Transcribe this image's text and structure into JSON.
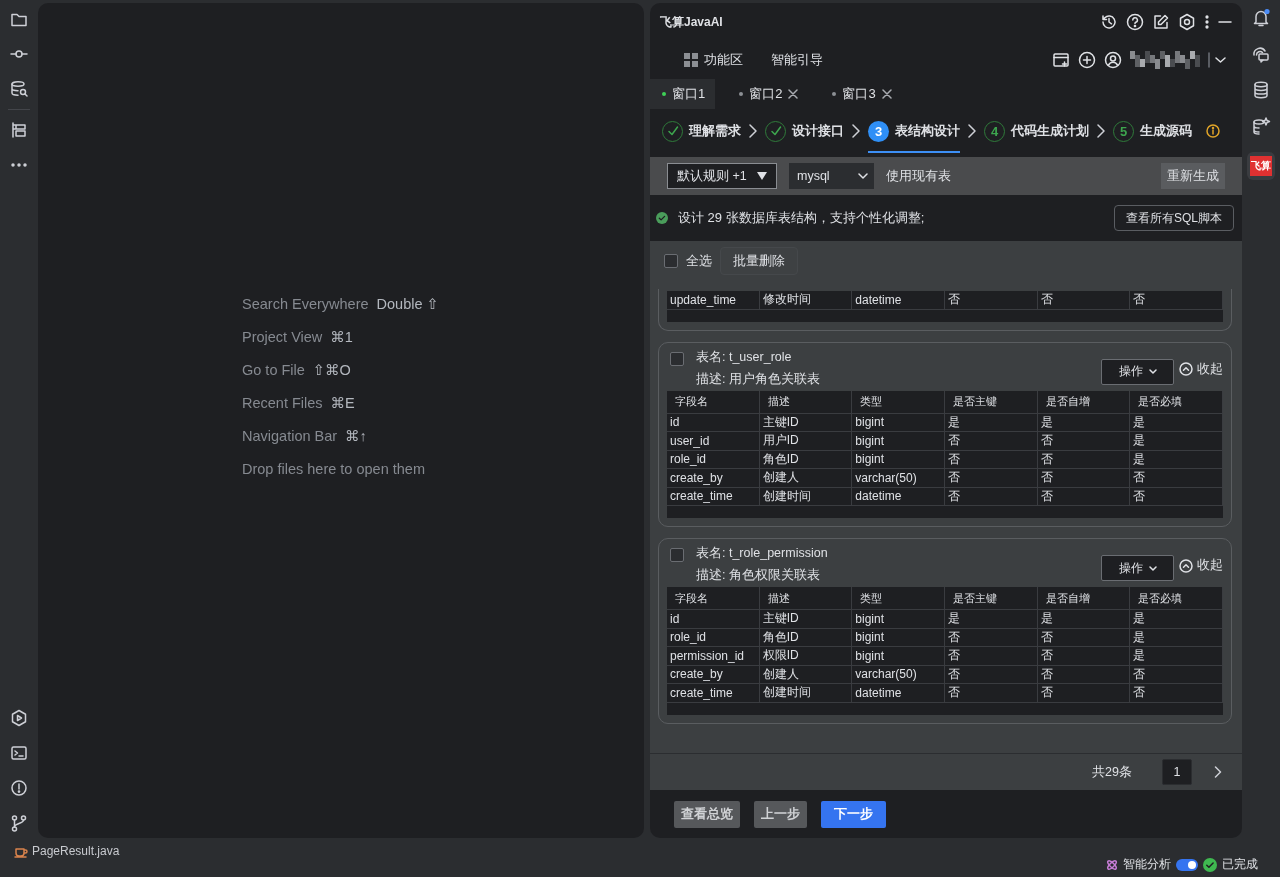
{
  "editor": {
    "hints": [
      {
        "action": "Search Everywhere",
        "shortcut": "Double ⇧"
      },
      {
        "action": "Project View",
        "shortcut": "⌘1"
      },
      {
        "action": "Go to File",
        "shortcut": "⇧⌘O"
      },
      {
        "action": "Recent Files",
        "shortcut": "⌘E"
      },
      {
        "action": "Navigation Bar",
        "shortcut": "⌘↑"
      },
      {
        "action": "Drop files here to open them"
      }
    ]
  },
  "plugin": {
    "title": "飞算JavaAI",
    "nav": [
      {
        "label": "功能区"
      },
      {
        "label": "智能引导"
      }
    ],
    "tabs": [
      {
        "label": "窗口1",
        "selected": true,
        "closable": false
      },
      {
        "label": "窗口2",
        "selected": false,
        "closable": true
      },
      {
        "label": "窗口3",
        "selected": false,
        "closable": true
      }
    ],
    "steps": [
      {
        "label": "理解需求",
        "done": true,
        "selected": false
      },
      {
        "label": "设计接口",
        "done": true,
        "selected": false
      },
      {
        "number": "3",
        "label": "表结构设计",
        "done": false,
        "selected": true
      },
      {
        "number": "4",
        "label": "代码生成计划",
        "done": false,
        "selected": false
      },
      {
        "number": "5",
        "label": "生成源码",
        "done": false,
        "selected": false
      }
    ],
    "toolbar": {
      "rules": "默认规则 +1",
      "database": "mysql",
      "existing": "使用现有表",
      "regenerate": "重新生成"
    },
    "info": {
      "text": "设计 29 张数据库表结构，支持个性化调整;",
      "button": "查看所有SQL脚本"
    },
    "select_all": {
      "label": "全选",
      "checked": false
    },
    "batch_delete": "批量删除",
    "tables": [
      {
        "kind": "partial",
        "rows": [
          [
            "update_time",
            "修改时间",
            "datetime",
            "否",
            "否",
            "否"
          ]
        ]
      },
      {
        "kind": "full",
        "name": "表名: t_user_role",
        "description": "描述: 用户角色关联表",
        "checked": false,
        "action": "操作",
        "collapse": "收起",
        "columns": [
          "字段名",
          "描述",
          "类型",
          "是否主键",
          "是否自增",
          "是否必填"
        ],
        "rows": [
          [
            "id",
            "主键ID",
            "bigint",
            "是",
            "是",
            "是"
          ],
          [
            "user_id",
            "用户ID",
            "bigint",
            "否",
            "否",
            "是"
          ],
          [
            "role_id",
            "角色ID",
            "bigint",
            "否",
            "否",
            "是"
          ],
          [
            "create_by",
            "创建人",
            "varchar(50)",
            "否",
            "否",
            "否"
          ],
          [
            "create_time",
            "创建时间",
            "datetime",
            "否",
            "否",
            "否"
          ]
        ]
      },
      {
        "kind": "full",
        "name": "表名: t_role_permission",
        "description": "描述: 角色权限关联表",
        "checked": false,
        "action": "操作",
        "collapse": "收起",
        "columns": [
          "字段名",
          "描述",
          "类型",
          "是否主键",
          "是否自增",
          "是否必填"
        ],
        "rows": [
          [
            "id",
            "主键ID",
            "bigint",
            "是",
            "是",
            "是"
          ],
          [
            "role_id",
            "角色ID",
            "bigint",
            "否",
            "否",
            "是"
          ],
          [
            "permission_id",
            "权限ID",
            "bigint",
            "否",
            "否",
            "是"
          ],
          [
            "create_by",
            "创建人",
            "varchar(50)",
            "否",
            "否",
            "否"
          ],
          [
            "create_time",
            "创建时间",
            "datetime",
            "否",
            "否",
            "否"
          ]
        ]
      }
    ],
    "pagination": {
      "total": "共29条",
      "page": "1"
    },
    "footer": [
      {
        "label": "查看总览",
        "kind": "secondary"
      },
      {
        "label": "上一步",
        "kind": "secondary"
      },
      {
        "label": "下一步",
        "kind": "primary"
      }
    ]
  },
  "right_bar": {
    "logo": "飞算"
  },
  "status_bar": {
    "file": "PageResult.java",
    "analysis": "智能分析",
    "analysis_on": true,
    "done": "已完成"
  }
}
